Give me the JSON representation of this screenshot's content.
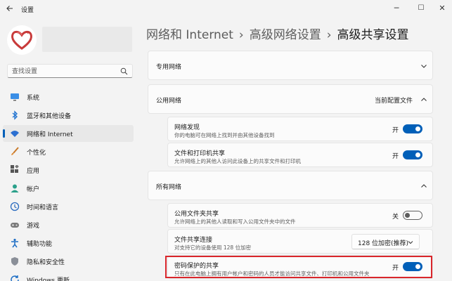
{
  "window": {
    "title": "设置",
    "back_icon": "back-arrow-icon",
    "controls": {
      "minimize": "─",
      "maximize": "☐",
      "close": "✕"
    }
  },
  "search": {
    "placeholder": "查找设置"
  },
  "sidebar": {
    "items": [
      {
        "label": "系统",
        "icon": "monitor-icon",
        "selected": false
      },
      {
        "label": "蓝牙和其他设备",
        "icon": "bluetooth-icon",
        "selected": false
      },
      {
        "label": "网络和 Internet",
        "icon": "wifi-icon",
        "selected": true
      },
      {
        "label": "个性化",
        "icon": "brush-icon",
        "selected": false
      },
      {
        "label": "应用",
        "icon": "apps-icon",
        "selected": false
      },
      {
        "label": "帐户",
        "icon": "person-icon",
        "selected": false
      },
      {
        "label": "时间和语言",
        "icon": "globe-clock-icon",
        "selected": false
      },
      {
        "label": "游戏",
        "icon": "gamepad-icon",
        "selected": false
      },
      {
        "label": "辅助功能",
        "icon": "accessibility-icon",
        "selected": false
      },
      {
        "label": "隐私和安全性",
        "icon": "shield-icon",
        "selected": false
      },
      {
        "label": "Windows 更新",
        "icon": "update-icon",
        "selected": false
      }
    ]
  },
  "breadcrumb": {
    "level1": "网络和 Internet",
    "level2": "高级网络设置",
    "current": "高级共享设置",
    "separator": "›"
  },
  "sections": {
    "private": {
      "title": "专用网络",
      "expanded": false
    },
    "public": {
      "title": "公用网络",
      "status": "当前配置文件",
      "expanded": true,
      "rows": [
        {
          "title": "网络发现",
          "desc": "你的电脑可在网络上找到并由其他设备找到",
          "toggle_label": "开",
          "on": true
        },
        {
          "title": "文件和打印机共享",
          "desc": "允许网络上的其他人访问此设备上的共享文件和打印机",
          "toggle_label": "开",
          "on": true
        }
      ]
    },
    "all": {
      "title": "所有网络",
      "expanded": true,
      "rows": [
        {
          "title": "公用文件夹共享",
          "desc": "允许网络上的其他人读取和写入公用文件夹中的文件",
          "toggle_label": "关",
          "on": false
        },
        {
          "title": "文件共享连接",
          "desc": "对支持它的设备使用 128 位加密",
          "dropdown_value": "128 位加密(推荐)"
        },
        {
          "title": "密码保护的共享",
          "desc": "只有在此电脑上拥有用户帐户和密码的人员才能访问共享文件、打印机和公用文件夹",
          "toggle_label": "开",
          "on": true
        }
      ]
    }
  },
  "colors": {
    "accent": "#005fb8",
    "highlight": "#d9262b",
    "background": "#f3f3f3"
  }
}
